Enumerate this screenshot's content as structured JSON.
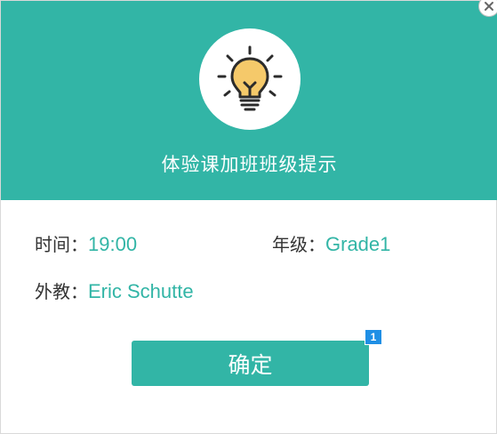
{
  "dialog": {
    "title": "体验课加班班级提示",
    "icon": "lightbulb-icon",
    "close_icon": "close-icon"
  },
  "info": {
    "time_label": "时间：",
    "time_value": "19:00",
    "grade_label": "年级：",
    "grade_value": "Grade1",
    "teacher_label": "外教：",
    "teacher_value": "Eric Schutte"
  },
  "actions": {
    "confirm_label": "确定",
    "badge_number": "1"
  },
  "colors": {
    "accent": "#32b5a6",
    "bulb": "#f5c96a",
    "badge": "#1f8fe5"
  }
}
